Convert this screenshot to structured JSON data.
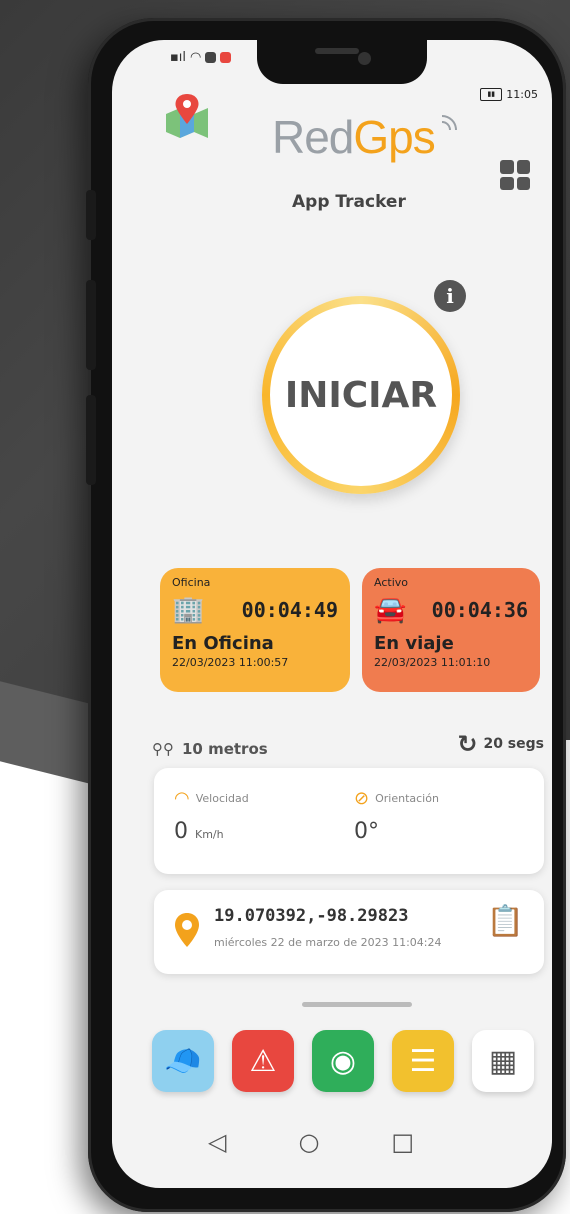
{
  "header": {
    "logo_left": "Red",
    "logo_right": "Gps",
    "title": "App Tracker",
    "time": "11:05",
    "icons": [
      "map-pin-icon",
      "grid-menu-icon",
      "wifi-icon",
      "battery-icon"
    ]
  },
  "start": {
    "label": "INICIAR",
    "info_label": "i"
  },
  "cards": {
    "office": {
      "label": "Oficina",
      "time": "00:04:49",
      "state": "En Oficina",
      "date": "22/03/2023 11:00:57",
      "color": "#f9b23a"
    },
    "trip": {
      "label": "Activo",
      "time": "00:04:36",
      "state": "En viaje",
      "date": "22/03/2023 11:01:10",
      "color": "#f07c4f"
    }
  },
  "distance": {
    "value": "10 metros"
  },
  "refresh": {
    "value": "20 segs"
  },
  "metrics": {
    "speed": {
      "label": "Velocidad",
      "value": "0",
      "unit": "Km/h"
    },
    "orientation": {
      "label": "Orientación",
      "value": "0°"
    }
  },
  "location": {
    "coords": "19.070392,-98.29823",
    "date": "miércoles 22 de marzo de 2023 11:04:24"
  },
  "dock": [
    {
      "name": "police",
      "icon": "police-cap-icon",
      "color": "#8fd0ef"
    },
    {
      "name": "alert",
      "icon": "warning-icon",
      "color": "#e8473f"
    },
    {
      "name": "camera",
      "icon": "webcam-icon",
      "color": "#2fae5a"
    },
    {
      "name": "checklist",
      "icon": "checklist-icon",
      "color": "#f2c12e"
    },
    {
      "name": "map",
      "icon": "map-board-icon",
      "color": "#ffffff"
    }
  ],
  "colors": {
    "accent": "#f3a21c",
    "text": "#444444"
  }
}
